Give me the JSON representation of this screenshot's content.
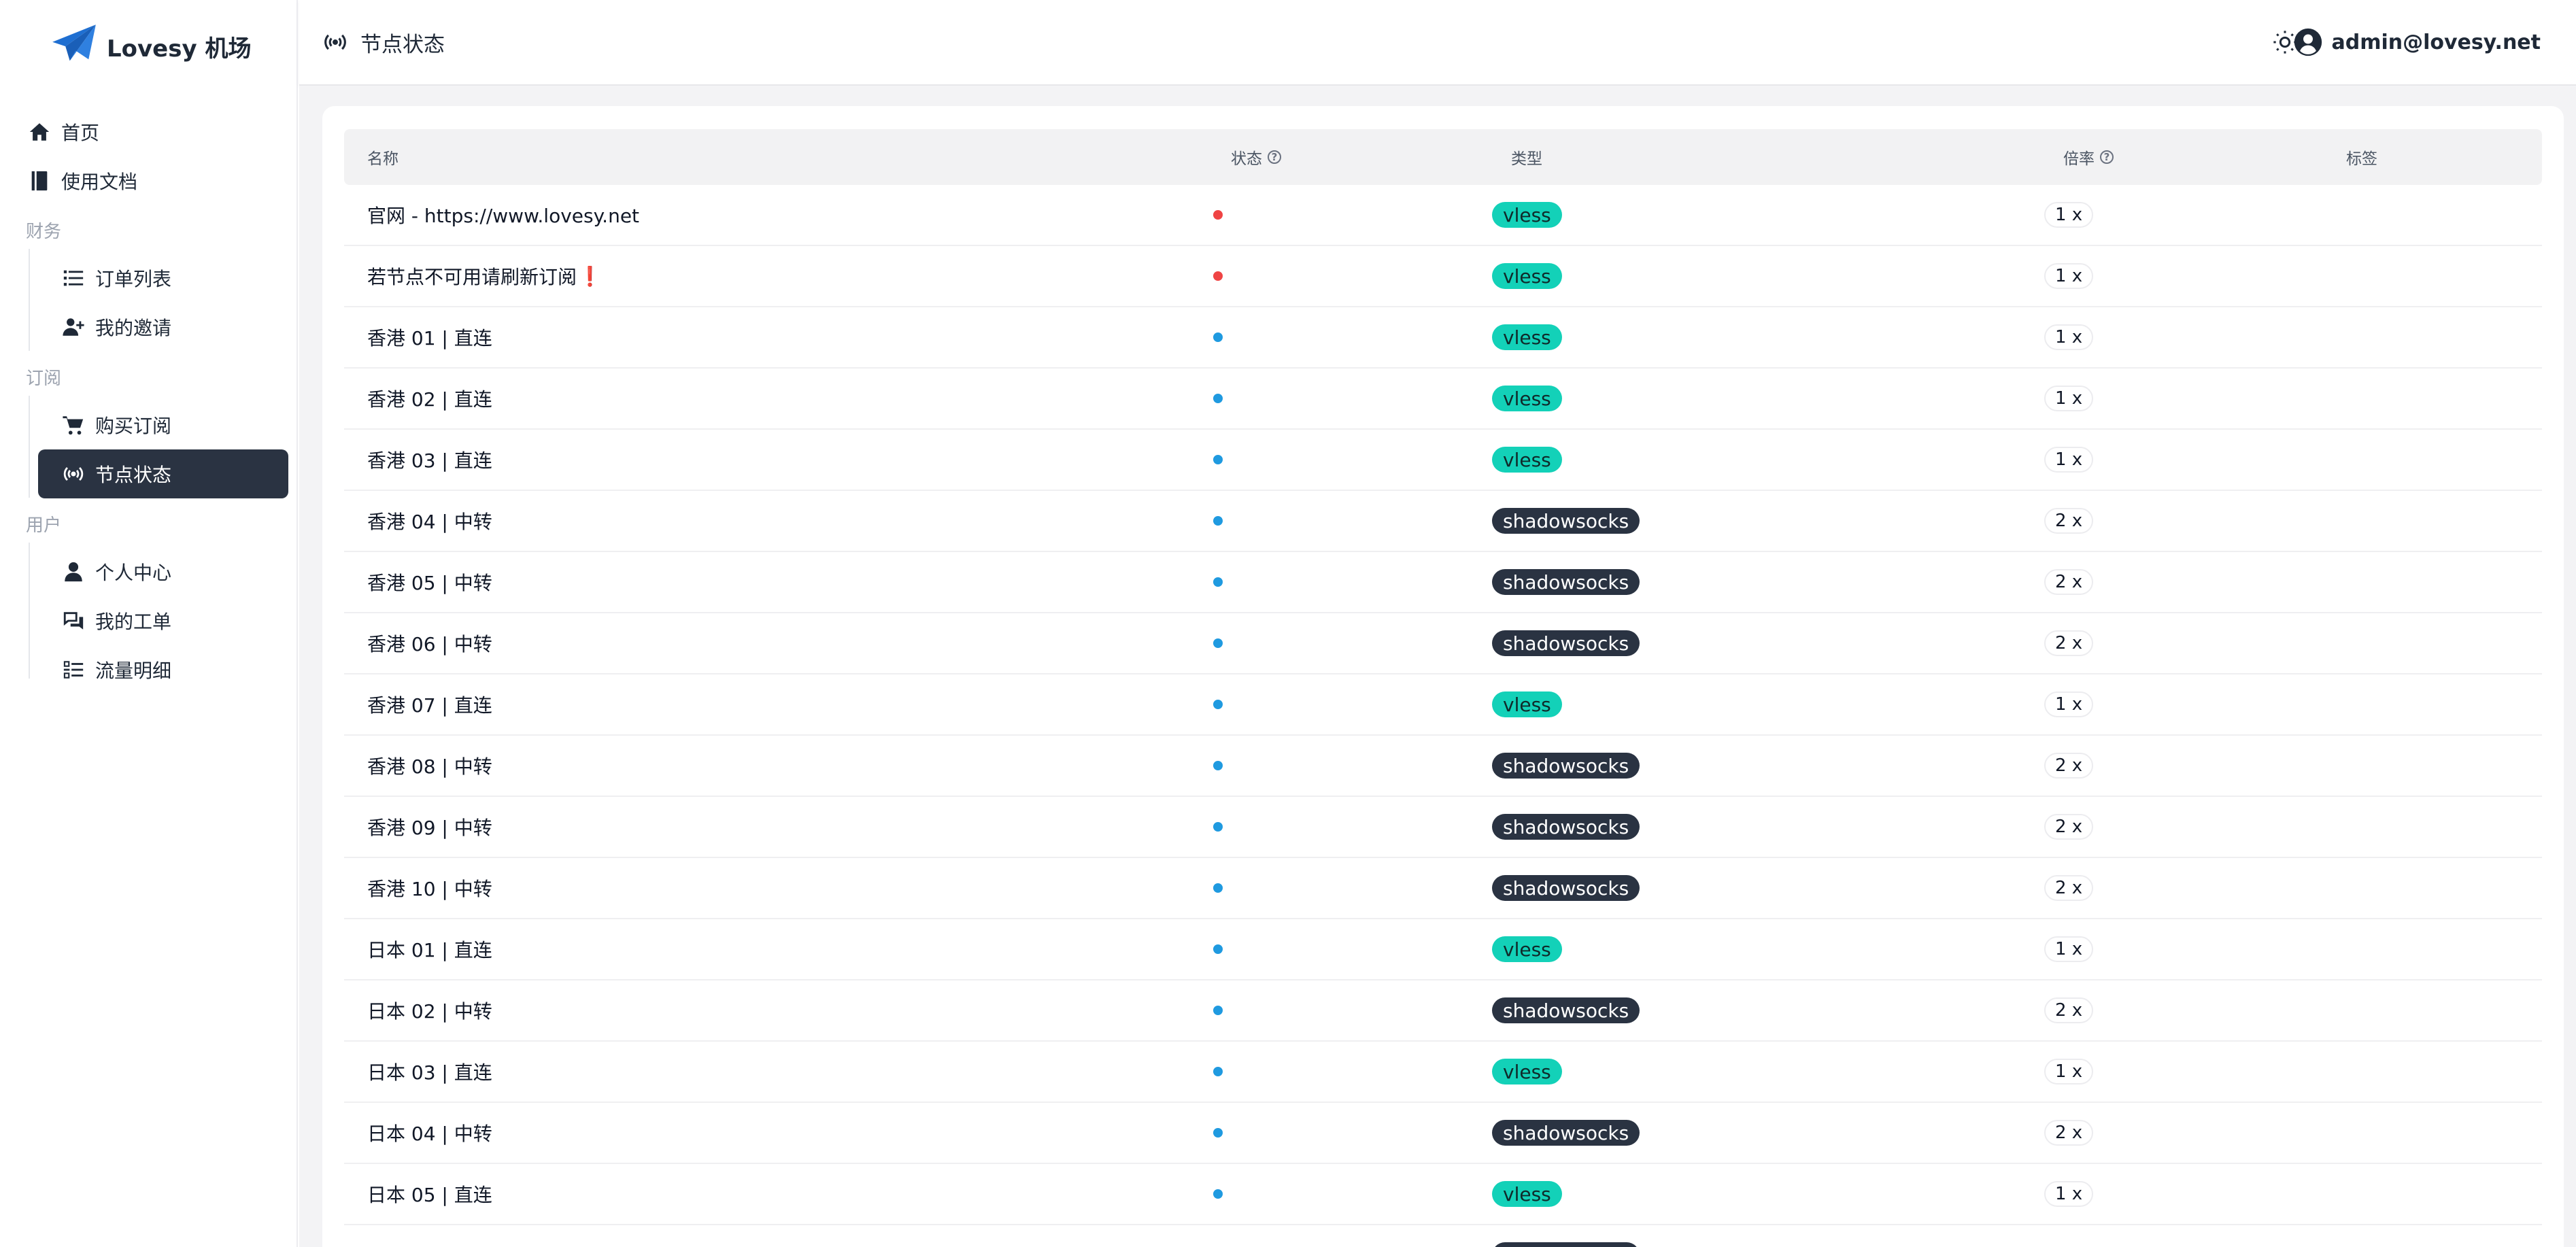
{
  "brand": {
    "name": "Lovesy 机场",
    "logo_icon": "paper-plane-icon",
    "color": "#1f6fd1"
  },
  "header": {
    "title": "节点状态",
    "title_icon": "broadcast-icon",
    "theme_icon": "sun-icon",
    "user_email": "admin@lovesy.net",
    "user_icon": "user-circle-icon"
  },
  "sidebar": {
    "home": "首页",
    "docs": "使用文档",
    "section_finance": "财务",
    "orders": "订单列表",
    "invites": "我的邀请",
    "section_subscribe": "订阅",
    "buy": "购买订阅",
    "node_status": "节点状态",
    "section_user": "用户",
    "profile": "个人中心",
    "tickets": "我的工单",
    "traffic": "流量明细"
  },
  "table": {
    "headers": {
      "name": "名称",
      "status": "状态",
      "type": "类型",
      "rate": "倍率",
      "tags": "标签"
    },
    "colors": {
      "status_offline": "#ef4444",
      "status_online": "#1f9ae0",
      "vless_bg": "#13d1b8",
      "shadowsocks_bg": "#2a3342"
    },
    "rows": [
      {
        "name": "官网 - https://www.lovesy.net",
        "status": "offline",
        "type": "vless",
        "rate": "1 x"
      },
      {
        "name": "若节点不可用请刷新订阅",
        "flag": "❗",
        "status": "offline",
        "type": "vless",
        "rate": "1 x"
      },
      {
        "name": "香港 01 | 直连",
        "status": "online",
        "type": "vless",
        "rate": "1 x"
      },
      {
        "name": "香港 02 | 直连",
        "status": "online",
        "type": "vless",
        "rate": "1 x"
      },
      {
        "name": "香港 03 | 直连",
        "status": "online",
        "type": "vless",
        "rate": "1 x"
      },
      {
        "name": "香港 04 | 中转",
        "status": "online",
        "type": "shadowsocks",
        "rate": "2 x"
      },
      {
        "name": "香港 05 | 中转",
        "status": "online",
        "type": "shadowsocks",
        "rate": "2 x"
      },
      {
        "name": "香港 06 | 中转",
        "status": "online",
        "type": "shadowsocks",
        "rate": "2 x"
      },
      {
        "name": "香港 07 | 直连",
        "status": "online",
        "type": "vless",
        "rate": "1 x"
      },
      {
        "name": "香港 08 | 中转",
        "status": "online",
        "type": "shadowsocks",
        "rate": "2 x"
      },
      {
        "name": "香港 09 | 中转",
        "status": "online",
        "type": "shadowsocks",
        "rate": "2 x"
      },
      {
        "name": "香港 10 | 中转",
        "status": "online",
        "type": "shadowsocks",
        "rate": "2 x"
      },
      {
        "name": "日本 01 | 直连",
        "status": "online",
        "type": "vless",
        "rate": "1 x"
      },
      {
        "name": "日本 02 | 中转",
        "status": "online",
        "type": "shadowsocks",
        "rate": "2 x"
      },
      {
        "name": "日本 03 | 直连",
        "status": "online",
        "type": "vless",
        "rate": "1 x"
      },
      {
        "name": "日本 04 | 中转",
        "status": "online",
        "type": "shadowsocks",
        "rate": "2 x"
      },
      {
        "name": "日本 05 | 直连",
        "status": "online",
        "type": "vless",
        "rate": "1 x"
      },
      {
        "name": "",
        "status": "online",
        "type": "shadowsocks",
        "rate": ""
      }
    ]
  }
}
